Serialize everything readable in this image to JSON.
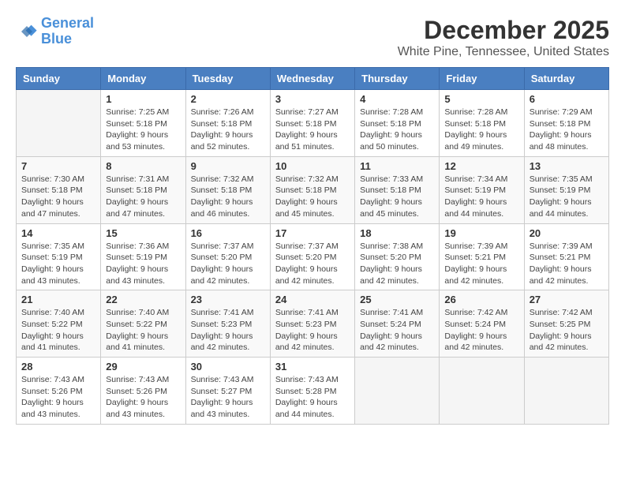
{
  "header": {
    "logo_line1": "General",
    "logo_line2": "Blue",
    "month_year": "December 2025",
    "location": "White Pine, Tennessee, United States"
  },
  "weekdays": [
    "Sunday",
    "Monday",
    "Tuesday",
    "Wednesday",
    "Thursday",
    "Friday",
    "Saturday"
  ],
  "weeks": [
    [
      {
        "day": "",
        "info": ""
      },
      {
        "day": "1",
        "info": "Sunrise: 7:25 AM\nSunset: 5:18 PM\nDaylight: 9 hours\nand 53 minutes."
      },
      {
        "day": "2",
        "info": "Sunrise: 7:26 AM\nSunset: 5:18 PM\nDaylight: 9 hours\nand 52 minutes."
      },
      {
        "day": "3",
        "info": "Sunrise: 7:27 AM\nSunset: 5:18 PM\nDaylight: 9 hours\nand 51 minutes."
      },
      {
        "day": "4",
        "info": "Sunrise: 7:28 AM\nSunset: 5:18 PM\nDaylight: 9 hours\nand 50 minutes."
      },
      {
        "day": "5",
        "info": "Sunrise: 7:28 AM\nSunset: 5:18 PM\nDaylight: 9 hours\nand 49 minutes."
      },
      {
        "day": "6",
        "info": "Sunrise: 7:29 AM\nSunset: 5:18 PM\nDaylight: 9 hours\nand 48 minutes."
      }
    ],
    [
      {
        "day": "7",
        "info": "Sunrise: 7:30 AM\nSunset: 5:18 PM\nDaylight: 9 hours\nand 47 minutes."
      },
      {
        "day": "8",
        "info": "Sunrise: 7:31 AM\nSunset: 5:18 PM\nDaylight: 9 hours\nand 47 minutes."
      },
      {
        "day": "9",
        "info": "Sunrise: 7:32 AM\nSunset: 5:18 PM\nDaylight: 9 hours\nand 46 minutes."
      },
      {
        "day": "10",
        "info": "Sunrise: 7:32 AM\nSunset: 5:18 PM\nDaylight: 9 hours\nand 45 minutes."
      },
      {
        "day": "11",
        "info": "Sunrise: 7:33 AM\nSunset: 5:18 PM\nDaylight: 9 hours\nand 45 minutes."
      },
      {
        "day": "12",
        "info": "Sunrise: 7:34 AM\nSunset: 5:19 PM\nDaylight: 9 hours\nand 44 minutes."
      },
      {
        "day": "13",
        "info": "Sunrise: 7:35 AM\nSunset: 5:19 PM\nDaylight: 9 hours\nand 44 minutes."
      }
    ],
    [
      {
        "day": "14",
        "info": "Sunrise: 7:35 AM\nSunset: 5:19 PM\nDaylight: 9 hours\nand 43 minutes."
      },
      {
        "day": "15",
        "info": "Sunrise: 7:36 AM\nSunset: 5:19 PM\nDaylight: 9 hours\nand 43 minutes."
      },
      {
        "day": "16",
        "info": "Sunrise: 7:37 AM\nSunset: 5:20 PM\nDaylight: 9 hours\nand 42 minutes."
      },
      {
        "day": "17",
        "info": "Sunrise: 7:37 AM\nSunset: 5:20 PM\nDaylight: 9 hours\nand 42 minutes."
      },
      {
        "day": "18",
        "info": "Sunrise: 7:38 AM\nSunset: 5:20 PM\nDaylight: 9 hours\nand 42 minutes."
      },
      {
        "day": "19",
        "info": "Sunrise: 7:39 AM\nSunset: 5:21 PM\nDaylight: 9 hours\nand 42 minutes."
      },
      {
        "day": "20",
        "info": "Sunrise: 7:39 AM\nSunset: 5:21 PM\nDaylight: 9 hours\nand 42 minutes."
      }
    ],
    [
      {
        "day": "21",
        "info": "Sunrise: 7:40 AM\nSunset: 5:22 PM\nDaylight: 9 hours\nand 41 minutes."
      },
      {
        "day": "22",
        "info": "Sunrise: 7:40 AM\nSunset: 5:22 PM\nDaylight: 9 hours\nand 41 minutes."
      },
      {
        "day": "23",
        "info": "Sunrise: 7:41 AM\nSunset: 5:23 PM\nDaylight: 9 hours\nand 42 minutes."
      },
      {
        "day": "24",
        "info": "Sunrise: 7:41 AM\nSunset: 5:23 PM\nDaylight: 9 hours\nand 42 minutes."
      },
      {
        "day": "25",
        "info": "Sunrise: 7:41 AM\nSunset: 5:24 PM\nDaylight: 9 hours\nand 42 minutes."
      },
      {
        "day": "26",
        "info": "Sunrise: 7:42 AM\nSunset: 5:24 PM\nDaylight: 9 hours\nand 42 minutes."
      },
      {
        "day": "27",
        "info": "Sunrise: 7:42 AM\nSunset: 5:25 PM\nDaylight: 9 hours\nand 42 minutes."
      }
    ],
    [
      {
        "day": "28",
        "info": "Sunrise: 7:43 AM\nSunset: 5:26 PM\nDaylight: 9 hours\nand 43 minutes."
      },
      {
        "day": "29",
        "info": "Sunrise: 7:43 AM\nSunset: 5:26 PM\nDaylight: 9 hours\nand 43 minutes."
      },
      {
        "day": "30",
        "info": "Sunrise: 7:43 AM\nSunset: 5:27 PM\nDaylight: 9 hours\nand 43 minutes."
      },
      {
        "day": "31",
        "info": "Sunrise: 7:43 AM\nSunset: 5:28 PM\nDaylight: 9 hours\nand 44 minutes."
      },
      {
        "day": "",
        "info": ""
      },
      {
        "day": "",
        "info": ""
      },
      {
        "day": "",
        "info": ""
      }
    ]
  ]
}
